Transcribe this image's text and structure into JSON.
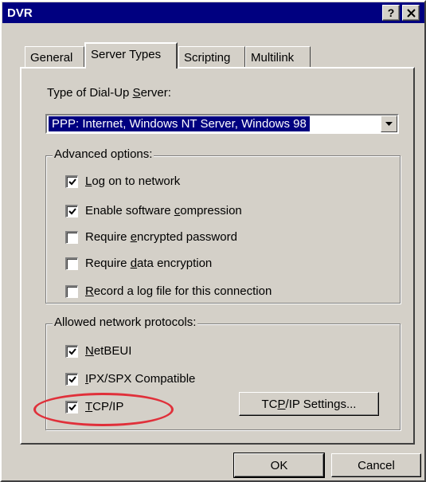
{
  "window": {
    "title": "DVR",
    "help_button": "?",
    "close_button": "✕"
  },
  "tabs": [
    {
      "label": "General",
      "active": false
    },
    {
      "label": "Server Types",
      "active": true
    },
    {
      "label": "Scripting",
      "active": false
    },
    {
      "label": "Multilink",
      "active": false
    }
  ],
  "server_type": {
    "label_prefix": "Type of Dial-Up ",
    "label_mnemonic": "S",
    "label_suffix": "erver:",
    "selected_value": "PPP: Internet, Windows NT Server, Windows 98"
  },
  "advanced_options": {
    "legend": "Advanced options:",
    "items": [
      {
        "pre": "",
        "mn": "L",
        "post": "og on to network",
        "checked": true
      },
      {
        "pre": "Enable software ",
        "mn": "c",
        "post": "ompression",
        "checked": true
      },
      {
        "pre": "Require ",
        "mn": "e",
        "post": "ncrypted password",
        "checked": false
      },
      {
        "pre": "Require ",
        "mn": "d",
        "post": "ata encryption",
        "checked": false
      },
      {
        "pre": "",
        "mn": "R",
        "post": "ecord a log file for this connection",
        "checked": false
      }
    ]
  },
  "protocols": {
    "legend": "Allowed network protocols:",
    "items": [
      {
        "pre": "",
        "mn": "N",
        "post": "etBEUI",
        "checked": true
      },
      {
        "pre": "",
        "mn": "I",
        "post": "PX/SPX Compatible",
        "checked": true
      },
      {
        "pre": "",
        "mn": "T",
        "post": "CP/IP",
        "checked": true
      }
    ],
    "settings_button": {
      "pre": "TC",
      "mn": "P",
      "post": "/IP Settings..."
    }
  },
  "footer": {
    "ok_label": "OK",
    "cancel_label": "Cancel"
  },
  "colors": {
    "face": "#d4d0c8",
    "title_bar": "#000080",
    "selection": "#000080",
    "annotation": "#e0303a"
  },
  "icons": {
    "checkmark": "checkmark-icon",
    "dropdown": "triangle-down-icon"
  }
}
